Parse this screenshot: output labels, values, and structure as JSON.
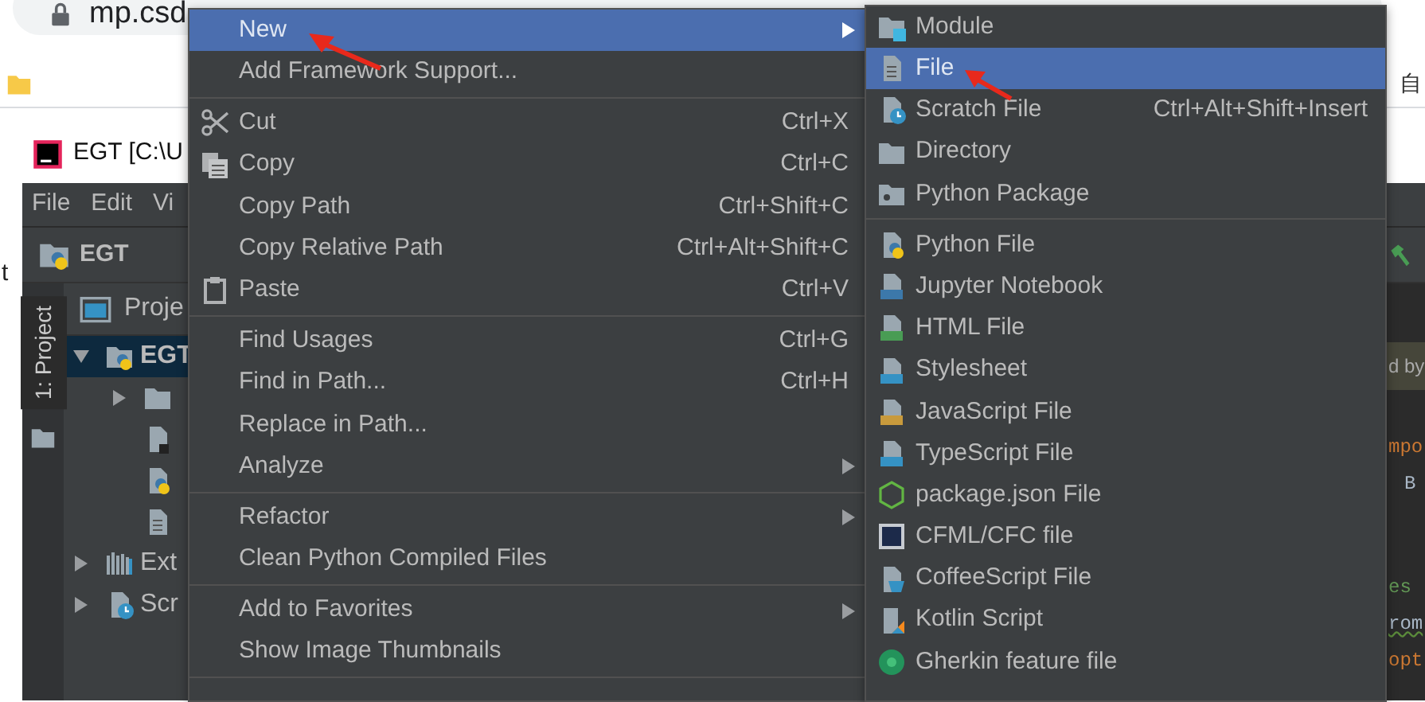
{
  "browser": {
    "address": "mp.csd",
    "bookmark_tail": "自",
    "side_text": "t"
  },
  "ide": {
    "title": "EGT [C:\\U",
    "menu": [
      "File",
      "Edit",
      "Vi"
    ],
    "breadcrumb": "EGT",
    "tool_window": "1: Project",
    "project": {
      "header": "Proje",
      "tree": [
        {
          "label": "EGT",
          "expanded": true,
          "selected": true,
          "children": [
            {
              "expanded": false,
              "selected": false
            },
            {
              "selected": false
            },
            {
              "selected": false
            },
            {
              "selected": false
            }
          ]
        },
        {
          "label": "Ext",
          "expanded": false,
          "selected": false
        },
        {
          "label": "Scr",
          "expanded": false,
          "selected": false
        }
      ]
    },
    "editor": [
      {
        "text": "d by",
        "kind": "banner"
      },
      {
        "text": "mpo",
        "kind": "keyword"
      },
      {
        "text": "B",
        "kind": "plain"
      },
      {
        "text": "es",
        "kind": "comment"
      },
      {
        "text": "rom",
        "kind": "warning"
      },
      {
        "text": "opt",
        "kind": "keyword"
      }
    ]
  },
  "context_menu": {
    "items": [
      {
        "kind": "item",
        "label": "New",
        "has_submenu": true,
        "selected": true
      },
      {
        "kind": "item",
        "label": "Add Framework Support...",
        "has_submenu": false,
        "selected": false
      },
      {
        "kind": "separator"
      },
      {
        "kind": "item",
        "label": "Cut",
        "shortcut": "Ctrl+X",
        "has_submenu": false,
        "selected": false
      },
      {
        "kind": "item",
        "label": "Copy",
        "shortcut": "Ctrl+C",
        "has_submenu": false,
        "selected": false
      },
      {
        "kind": "item",
        "label": "Copy Path",
        "shortcut": "Ctrl+Shift+C",
        "has_submenu": false,
        "selected": false
      },
      {
        "kind": "item",
        "label": "Copy Relative Path",
        "shortcut": "Ctrl+Alt+Shift+C",
        "has_submenu": false,
        "selected": false
      },
      {
        "kind": "item",
        "label": "Paste",
        "shortcut": "Ctrl+V",
        "has_submenu": false,
        "selected": false
      },
      {
        "kind": "separator"
      },
      {
        "kind": "item",
        "label": "Find Usages",
        "shortcut": "Ctrl+G",
        "has_submenu": false,
        "selected": false
      },
      {
        "kind": "item",
        "label": "Find in Path...",
        "shortcut": "Ctrl+H",
        "has_submenu": false,
        "selected": false
      },
      {
        "kind": "item",
        "label": "Replace in Path...",
        "has_submenu": false,
        "selected": false
      },
      {
        "kind": "item",
        "label": "Analyze",
        "has_submenu": true,
        "selected": false
      },
      {
        "kind": "separator"
      },
      {
        "kind": "item",
        "label": "Refactor",
        "has_submenu": true,
        "selected": false
      },
      {
        "kind": "item",
        "label": "Clean Python Compiled Files",
        "has_submenu": false,
        "selected": false
      },
      {
        "kind": "separator"
      },
      {
        "kind": "item",
        "label": "Add to Favorites",
        "has_submenu": true,
        "selected": false
      },
      {
        "kind": "item",
        "label": "Show Image Thumbnails",
        "has_submenu": false,
        "selected": false
      },
      {
        "kind": "separator"
      }
    ]
  },
  "submenu": {
    "items": [
      {
        "kind": "item",
        "label": "Module",
        "selected": false
      },
      {
        "kind": "item",
        "label": "File",
        "selected": true
      },
      {
        "kind": "item",
        "label": "Scratch File",
        "shortcut": "Ctrl+Alt+Shift+Insert",
        "selected": false
      },
      {
        "kind": "item",
        "label": "Directory",
        "selected": false
      },
      {
        "kind": "item",
        "label": "Python Package",
        "selected": false
      },
      {
        "kind": "separator"
      },
      {
        "kind": "item",
        "label": "Python File",
        "selected": false
      },
      {
        "kind": "item",
        "label": "Jupyter Notebook",
        "selected": false
      },
      {
        "kind": "item",
        "label": "HTML File",
        "selected": false
      },
      {
        "kind": "item",
        "label": "Stylesheet",
        "selected": false
      },
      {
        "kind": "item",
        "label": "JavaScript File",
        "selected": false
      },
      {
        "kind": "item",
        "label": "TypeScript File",
        "selected": false
      },
      {
        "kind": "item",
        "label": "package.json File",
        "selected": false
      },
      {
        "kind": "item",
        "label": "CFML/CFC file",
        "selected": false
      },
      {
        "kind": "item",
        "label": "CoffeeScript File",
        "selected": false
      },
      {
        "kind": "item",
        "label": "Kotlin Script",
        "selected": false
      },
      {
        "kind": "item",
        "label": "Gherkin feature file",
        "selected": false
      }
    ]
  }
}
